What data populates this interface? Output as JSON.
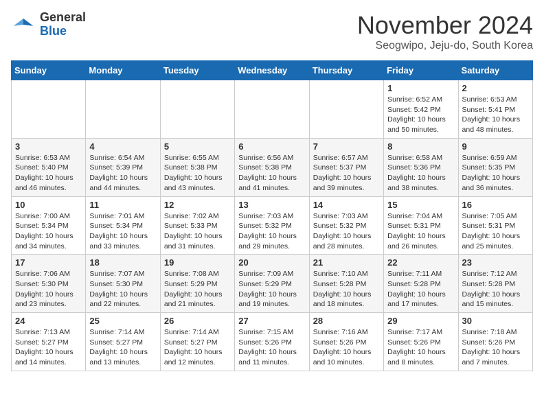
{
  "header": {
    "logo_general": "General",
    "logo_blue": "Blue",
    "month_title": "November 2024",
    "location": "Seogwipo, Jeju-do, South Korea"
  },
  "weekdays": [
    "Sunday",
    "Monday",
    "Tuesday",
    "Wednesday",
    "Thursday",
    "Friday",
    "Saturday"
  ],
  "weeks": [
    [
      {
        "day": "",
        "info": ""
      },
      {
        "day": "",
        "info": ""
      },
      {
        "day": "",
        "info": ""
      },
      {
        "day": "",
        "info": ""
      },
      {
        "day": "",
        "info": ""
      },
      {
        "day": "1",
        "info": "Sunrise: 6:52 AM\nSunset: 5:42 PM\nDaylight: 10 hours and 50 minutes."
      },
      {
        "day": "2",
        "info": "Sunrise: 6:53 AM\nSunset: 5:41 PM\nDaylight: 10 hours and 48 minutes."
      }
    ],
    [
      {
        "day": "3",
        "info": "Sunrise: 6:53 AM\nSunset: 5:40 PM\nDaylight: 10 hours and 46 minutes."
      },
      {
        "day": "4",
        "info": "Sunrise: 6:54 AM\nSunset: 5:39 PM\nDaylight: 10 hours and 44 minutes."
      },
      {
        "day": "5",
        "info": "Sunrise: 6:55 AM\nSunset: 5:38 PM\nDaylight: 10 hours and 43 minutes."
      },
      {
        "day": "6",
        "info": "Sunrise: 6:56 AM\nSunset: 5:38 PM\nDaylight: 10 hours and 41 minutes."
      },
      {
        "day": "7",
        "info": "Sunrise: 6:57 AM\nSunset: 5:37 PM\nDaylight: 10 hours and 39 minutes."
      },
      {
        "day": "8",
        "info": "Sunrise: 6:58 AM\nSunset: 5:36 PM\nDaylight: 10 hours and 38 minutes."
      },
      {
        "day": "9",
        "info": "Sunrise: 6:59 AM\nSunset: 5:35 PM\nDaylight: 10 hours and 36 minutes."
      }
    ],
    [
      {
        "day": "10",
        "info": "Sunrise: 7:00 AM\nSunset: 5:34 PM\nDaylight: 10 hours and 34 minutes."
      },
      {
        "day": "11",
        "info": "Sunrise: 7:01 AM\nSunset: 5:34 PM\nDaylight: 10 hours and 33 minutes."
      },
      {
        "day": "12",
        "info": "Sunrise: 7:02 AM\nSunset: 5:33 PM\nDaylight: 10 hours and 31 minutes."
      },
      {
        "day": "13",
        "info": "Sunrise: 7:03 AM\nSunset: 5:32 PM\nDaylight: 10 hours and 29 minutes."
      },
      {
        "day": "14",
        "info": "Sunrise: 7:03 AM\nSunset: 5:32 PM\nDaylight: 10 hours and 28 minutes."
      },
      {
        "day": "15",
        "info": "Sunrise: 7:04 AM\nSunset: 5:31 PM\nDaylight: 10 hours and 26 minutes."
      },
      {
        "day": "16",
        "info": "Sunrise: 7:05 AM\nSunset: 5:31 PM\nDaylight: 10 hours and 25 minutes."
      }
    ],
    [
      {
        "day": "17",
        "info": "Sunrise: 7:06 AM\nSunset: 5:30 PM\nDaylight: 10 hours and 23 minutes."
      },
      {
        "day": "18",
        "info": "Sunrise: 7:07 AM\nSunset: 5:30 PM\nDaylight: 10 hours and 22 minutes."
      },
      {
        "day": "19",
        "info": "Sunrise: 7:08 AM\nSunset: 5:29 PM\nDaylight: 10 hours and 21 minutes."
      },
      {
        "day": "20",
        "info": "Sunrise: 7:09 AM\nSunset: 5:29 PM\nDaylight: 10 hours and 19 minutes."
      },
      {
        "day": "21",
        "info": "Sunrise: 7:10 AM\nSunset: 5:28 PM\nDaylight: 10 hours and 18 minutes."
      },
      {
        "day": "22",
        "info": "Sunrise: 7:11 AM\nSunset: 5:28 PM\nDaylight: 10 hours and 17 minutes."
      },
      {
        "day": "23",
        "info": "Sunrise: 7:12 AM\nSunset: 5:28 PM\nDaylight: 10 hours and 15 minutes."
      }
    ],
    [
      {
        "day": "24",
        "info": "Sunrise: 7:13 AM\nSunset: 5:27 PM\nDaylight: 10 hours and 14 minutes."
      },
      {
        "day": "25",
        "info": "Sunrise: 7:14 AM\nSunset: 5:27 PM\nDaylight: 10 hours and 13 minutes."
      },
      {
        "day": "26",
        "info": "Sunrise: 7:14 AM\nSunset: 5:27 PM\nDaylight: 10 hours and 12 minutes."
      },
      {
        "day": "27",
        "info": "Sunrise: 7:15 AM\nSunset: 5:26 PM\nDaylight: 10 hours and 11 minutes."
      },
      {
        "day": "28",
        "info": "Sunrise: 7:16 AM\nSunset: 5:26 PM\nDaylight: 10 hours and 10 minutes."
      },
      {
        "day": "29",
        "info": "Sunrise: 7:17 AM\nSunset: 5:26 PM\nDaylight: 10 hours and 8 minutes."
      },
      {
        "day": "30",
        "info": "Sunrise: 7:18 AM\nSunset: 5:26 PM\nDaylight: 10 hours and 7 minutes."
      }
    ]
  ]
}
